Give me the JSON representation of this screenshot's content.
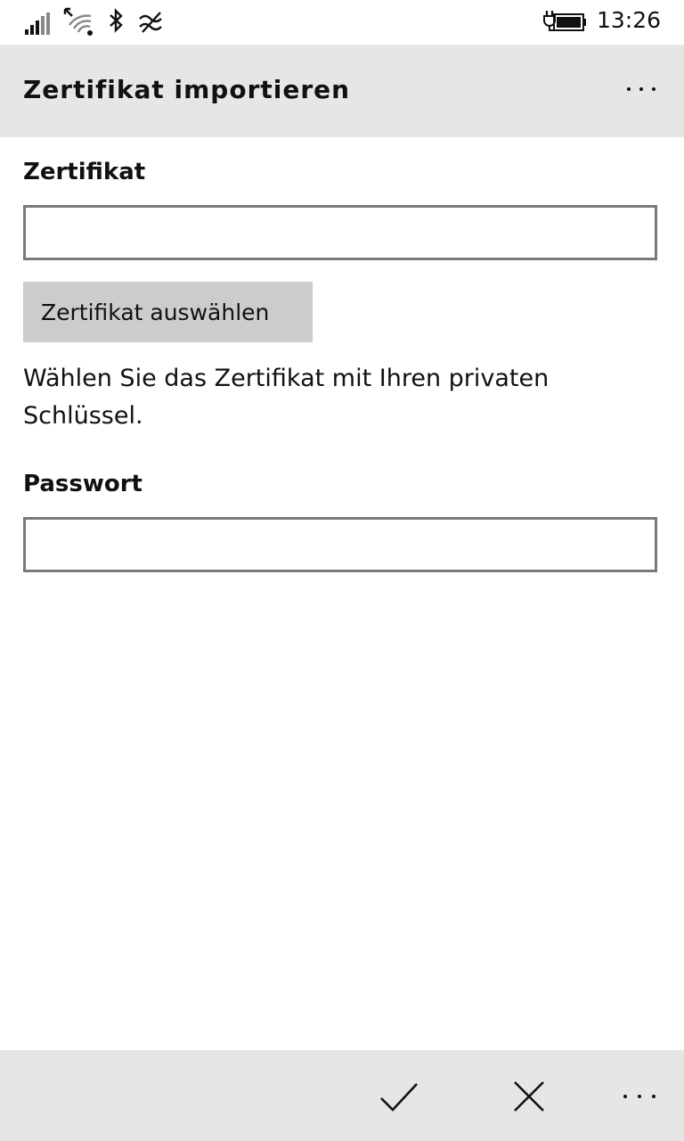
{
  "status_bar": {
    "time": "13:26",
    "icons": [
      "signal-strength-icon",
      "wifi-icon",
      "bluetooth-icon",
      "data-sense-icon",
      "battery-charging-icon"
    ]
  },
  "header": {
    "title": "Zertifikat importieren",
    "more_icon": "ellipsis-icon"
  },
  "form": {
    "certificate_label": "Zertifikat",
    "certificate_value": "",
    "select_button_label": "Zertifikat auswählen",
    "helper_text": "Wählen Sie das Zertifikat mit Ihren privaten Schlüssel.",
    "password_label": "Passwort",
    "password_value": ""
  },
  "app_bar": {
    "icons": [
      "checkmark-icon",
      "close-icon",
      "ellipsis-icon"
    ]
  }
}
